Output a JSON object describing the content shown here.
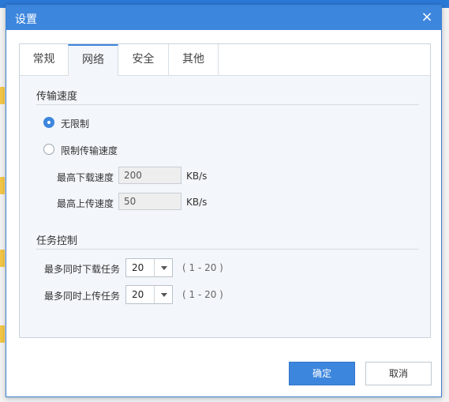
{
  "dialog": {
    "title": "设置",
    "close_glyph": "×"
  },
  "tabs": [
    {
      "label": "常规",
      "active": false
    },
    {
      "label": "网络",
      "active": true
    },
    {
      "label": "安全",
      "active": false
    },
    {
      "label": "其他",
      "active": false
    }
  ],
  "speed": {
    "section_title": "传输速度",
    "option_unlimited": "无限制",
    "option_limited": "限制传输速度",
    "selected": "无限制",
    "max_download_label": "最高下载速度",
    "max_download_value": "200",
    "max_upload_label": "最高上传速度",
    "max_upload_value": "50",
    "unit": "KB/s"
  },
  "tasks": {
    "section_title": "任务控制",
    "max_download_label": "最多同时下载任务",
    "max_download_value": "20",
    "max_upload_label": "最多同时上传任务",
    "max_upload_value": "20",
    "range_hint": "( 1 - 20 )"
  },
  "buttons": {
    "ok": "确定",
    "cancel": "取消"
  },
  "colors": {
    "accent": "#3d86dd",
    "panel_bg": "#f3f6fa"
  }
}
